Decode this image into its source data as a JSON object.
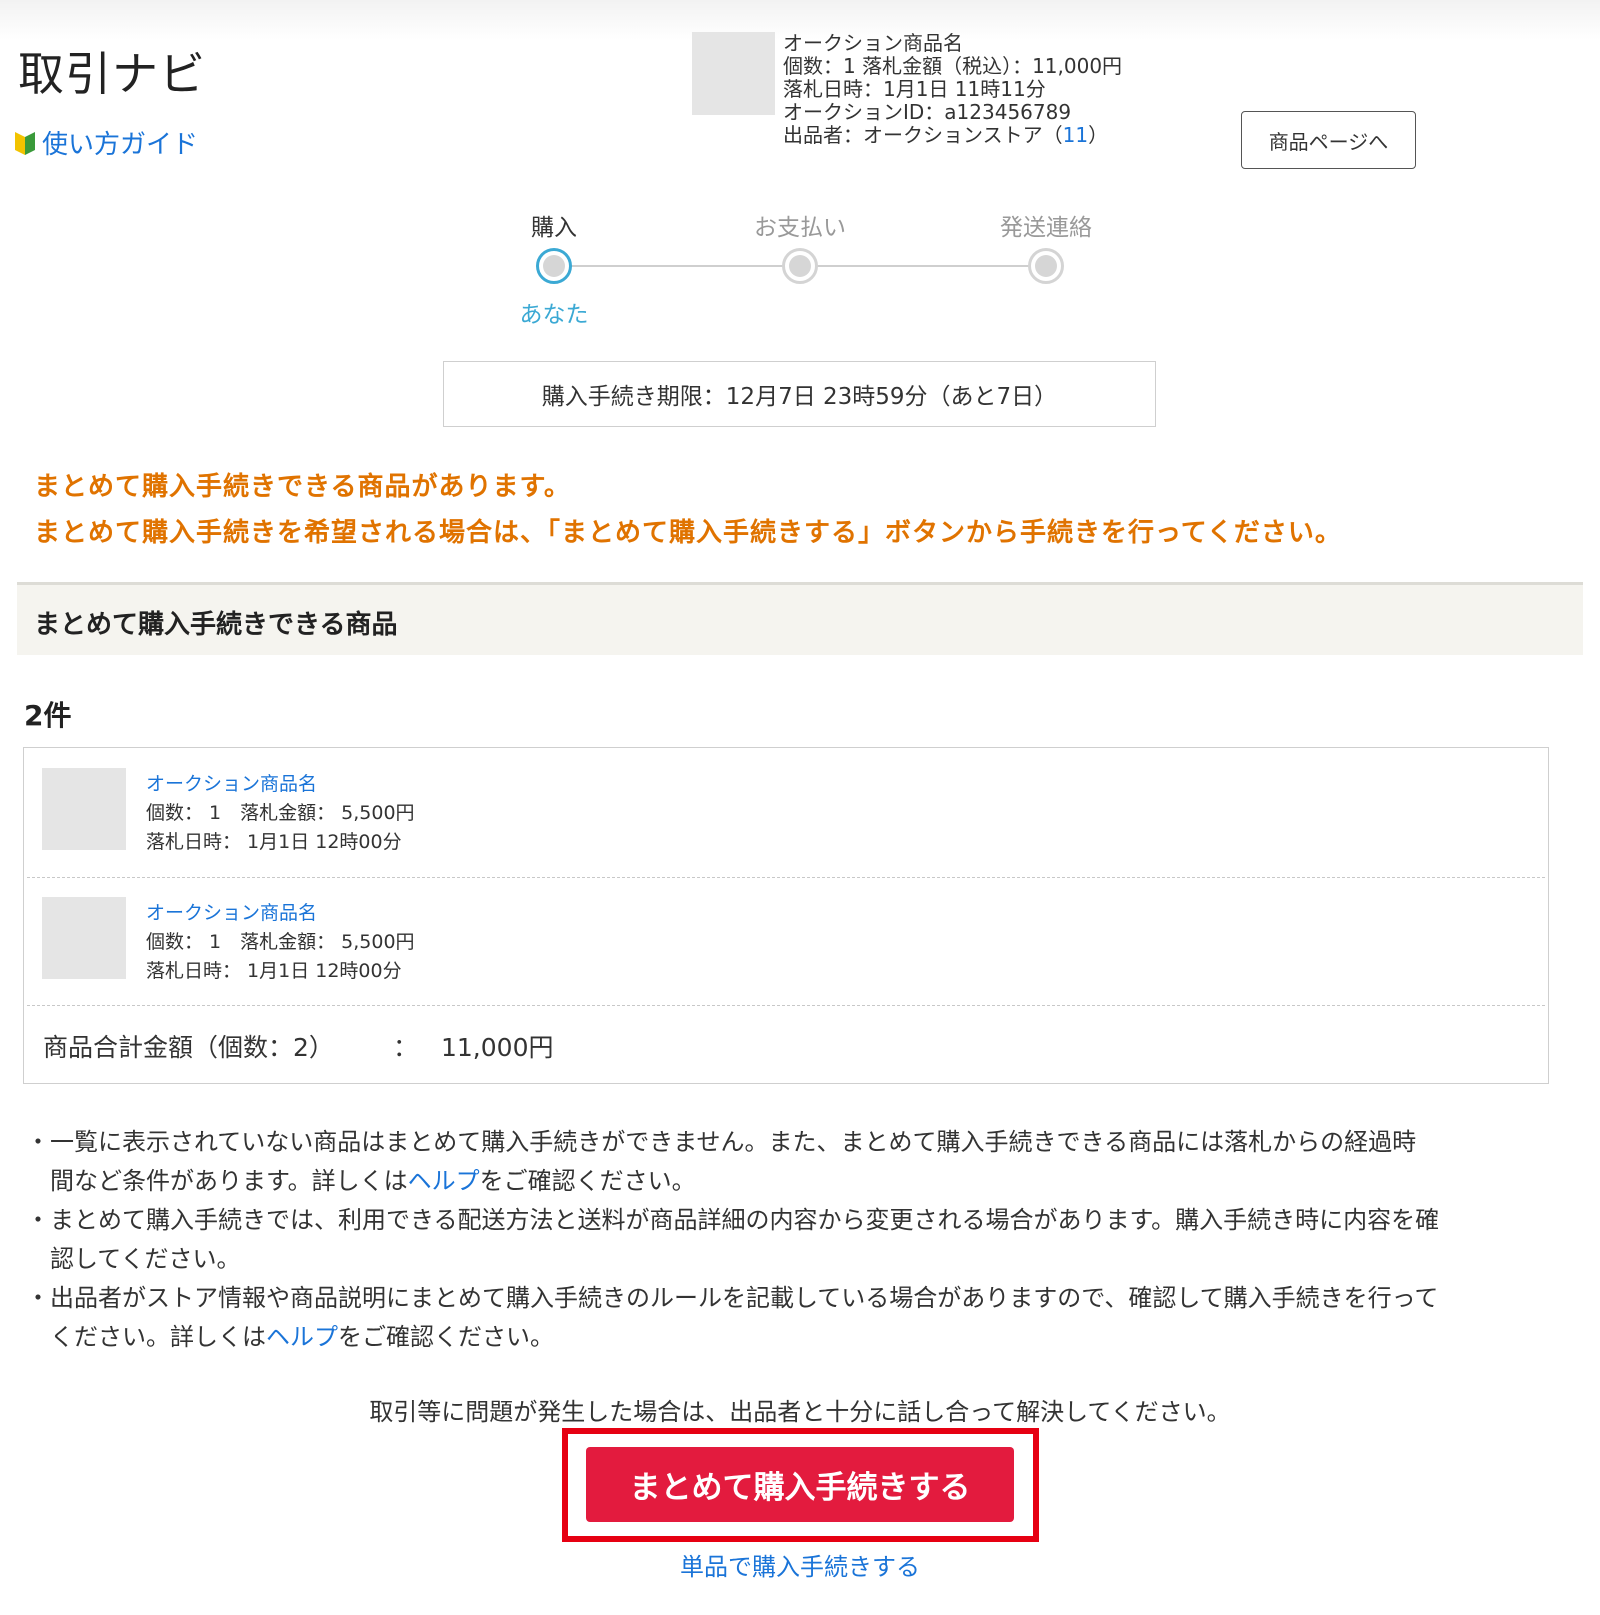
{
  "header": {
    "title": "取引ナビ",
    "guide_label": "使い方ガイド"
  },
  "item": {
    "name": "オークション商品名",
    "quantity_price": "個数：1 落札金額（税込）：11,000円",
    "date": "落札日時：1月1日 11時11分",
    "auction_id": "オークションID：a123456789",
    "seller_prefix": "出品者：オークションストア（",
    "seller_rating": "11",
    "seller_suffix": "）",
    "product_page_button": "商品ページへ"
  },
  "steps": [
    {
      "label": "購入",
      "active": true
    },
    {
      "label": "お支払い",
      "active": false
    },
    {
      "label": "発送連絡",
      "active": false
    }
  ],
  "step_actor": "あなた",
  "deadline": "購入手続き期限：12月7日 23時59分（あと7日）",
  "notice": {
    "line1": "まとめて購入手続きできる商品があります。",
    "line2": "まとめて購入手続きを希望される場合は、「まとめて購入手続きする」ボタンから手続きを行ってください。"
  },
  "bundle": {
    "section_title": "まとめて購入手続きできる商品",
    "count": "2件",
    "items": [
      {
        "name": "オークション商品名",
        "line1": "個数： 1　落札金額： 5,500円",
        "line2": "落札日時： 1月1日 12時00分"
      },
      {
        "name": "オークション商品名",
        "line1": "個数： 1　落札金額： 5,500円",
        "line2": "落札日時： 1月1日 12時00分"
      }
    ],
    "total_label": "商品合計金額（個数：2）",
    "total_colon": "：",
    "total_value": "11,000円"
  },
  "notes": {
    "bullet": "・",
    "n1_a": "一覧に表示されていない商品はまとめて購入手続きができません。また、まとめて購入手続きできる商品には落札からの経過時",
    "n1_b": "間など条件があります。詳しくは",
    "n1_link": "ヘルプ",
    "n1_c": "をご確認ください。",
    "n2_a": "まとめて購入手続きでは、利用できる配送方法と送料が商品詳細の内容から変更される場合があります。購入手続き時に内容を確",
    "n2_b": "認してください。",
    "n3_a": "出品者がストア情報や商品説明にまとめて購入手続きのルールを記載している場合がありますので、確認して購入手続きを行って",
    "n3_b": "ください。詳しくは",
    "n3_link": "ヘルプ",
    "n3_c": "をご確認ください。"
  },
  "trouble_text": "取引等に問題が発生した場合は、出品者と十分に話し合って解決してください。",
  "buttons": {
    "bundle_purchase": "まとめて購入手続きする",
    "single_purchase": "単品で購入手続きする"
  },
  "colors": {
    "accent_blue": "#3ba9d4",
    "link": "#1a74d8",
    "notice_orange": "#e07300",
    "primary_button": "#e31b3e",
    "highlight_border": "#e60012"
  },
  "icons": {
    "guide": "beginner-mark-icon"
  }
}
